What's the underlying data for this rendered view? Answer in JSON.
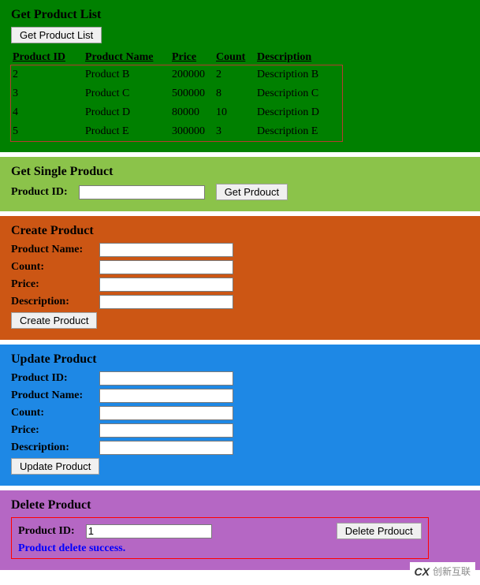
{
  "listPanel": {
    "title": "Get Product List",
    "buttonLabel": "Get Product List",
    "columns": [
      "Product ID",
      "Product Name",
      "Price",
      "Count",
      "Description"
    ],
    "rows": [
      {
        "id": "2",
        "name": "Product B",
        "price": "200000",
        "count": "2",
        "desc": "Description B"
      },
      {
        "id": "3",
        "name": "Product C",
        "price": "500000",
        "count": "8",
        "desc": "Description C"
      },
      {
        "id": "4",
        "name": "Product D",
        "price": "80000",
        "count": "10",
        "desc": "Description D"
      },
      {
        "id": "5",
        "name": "Product E",
        "price": "300000",
        "count": "3",
        "desc": "Description E"
      }
    ]
  },
  "singlePanel": {
    "title": "Get Single Product",
    "idLabel": "Product ID:",
    "buttonLabel": "Get Prdouct",
    "idValue": ""
  },
  "createPanel": {
    "title": "Create Product",
    "nameLabel": "Product Name:",
    "countLabel": "Count:",
    "priceLabel": "Price:",
    "descLabel": "Description:",
    "buttonLabel": "Create Product",
    "nameValue": "",
    "countValue": "",
    "priceValue": "",
    "descValue": ""
  },
  "updatePanel": {
    "title": "Update Product",
    "idLabel": "Product ID:",
    "nameLabel": "Product Name:",
    "countLabel": "Count:",
    "priceLabel": "Price:",
    "descLabel": "Description:",
    "buttonLabel": "Update Product",
    "idValue": "",
    "nameValue": "",
    "countValue": "",
    "priceValue": "",
    "descValue": ""
  },
  "deletePanel": {
    "title": "Delete Product",
    "idLabel": "Product ID:",
    "buttonLabel": "Delete Prdouct",
    "idValue": "1",
    "statusMsg": "Product delete success."
  },
  "watermark": {
    "logo": "CX",
    "text": "创新互联"
  }
}
